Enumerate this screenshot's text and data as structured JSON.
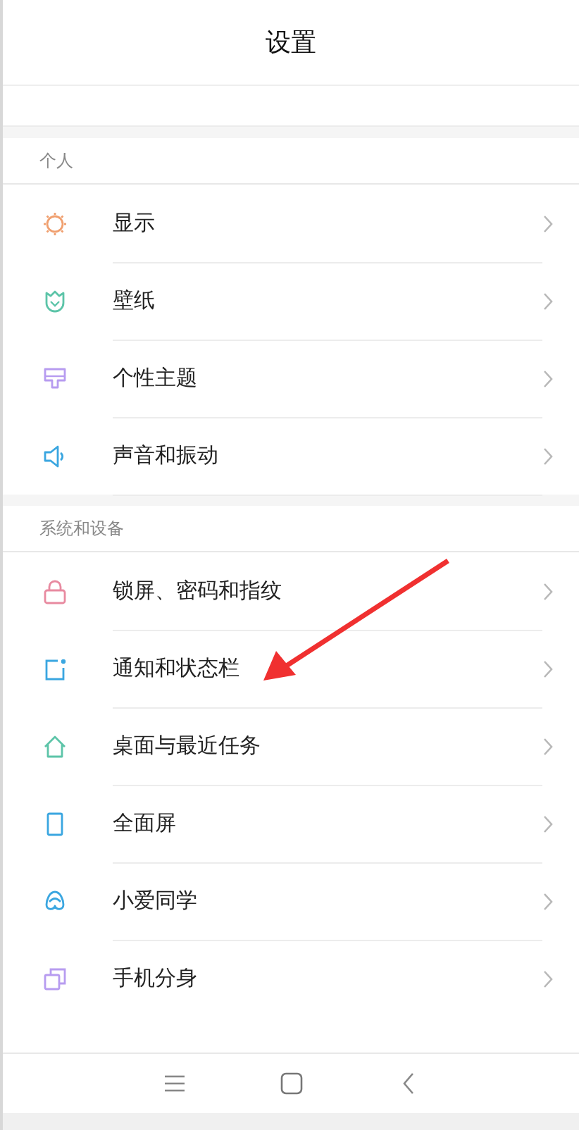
{
  "header": {
    "title": "设置"
  },
  "sections": [
    {
      "title": "个人",
      "items": [
        {
          "label": "显示",
          "color": "#f0a070"
        },
        {
          "label": "壁纸",
          "color": "#5cc4a8"
        },
        {
          "label": "个性主题",
          "color": "#b79cf0"
        },
        {
          "label": "声音和振动",
          "color": "#3aa6e0"
        }
      ]
    },
    {
      "title": "系统和设备",
      "items": [
        {
          "label": "锁屏、密码和指纹",
          "color": "#e88aa0"
        },
        {
          "label": "通知和状态栏",
          "color": "#3aa6e0"
        },
        {
          "label": "桌面与最近任务",
          "color": "#5cc4a8"
        },
        {
          "label": "全面屏",
          "color": "#3aa6e0"
        },
        {
          "label": "小爱同学",
          "color": "#3aa6e0"
        },
        {
          "label": "手机分身",
          "color": "#b79cf0"
        }
      ]
    }
  ],
  "nav": [
    {
      "kind": "menu"
    },
    {
      "kind": "home"
    },
    {
      "kind": "back"
    }
  ]
}
